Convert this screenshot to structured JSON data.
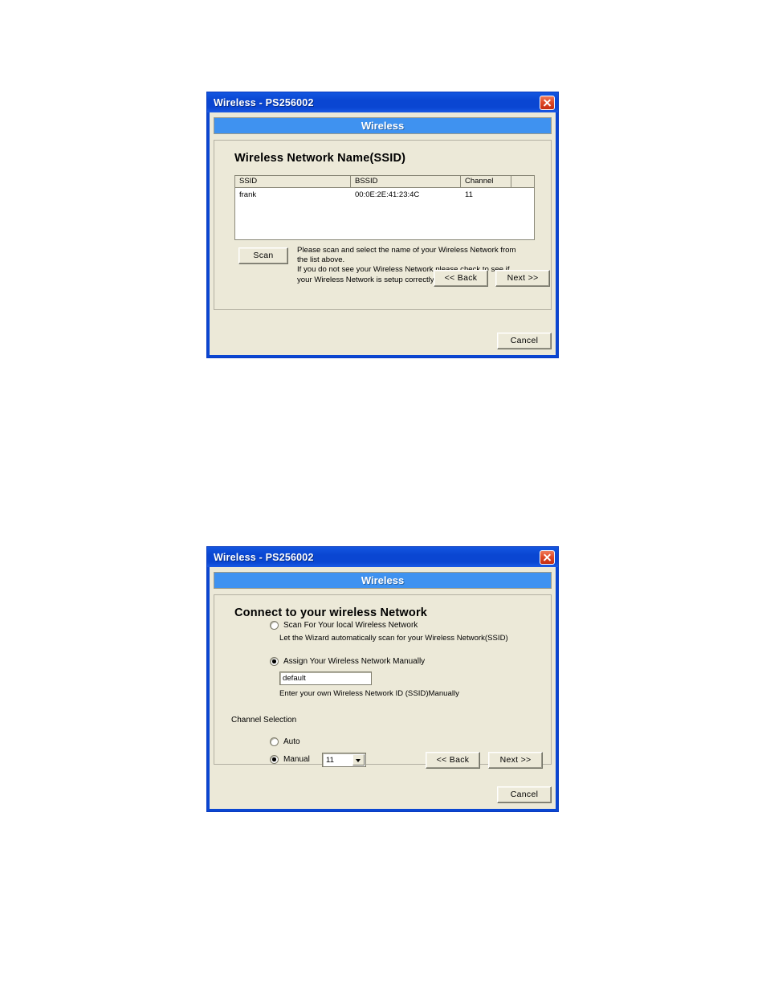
{
  "dialog1": {
    "title": "Wireless - PS256002",
    "close_icon": "close-icon",
    "banner": "Wireless",
    "section_title": "Wireless Network Name(SSID)",
    "table": {
      "columns": [
        "SSID",
        "BSSID",
        "Channel",
        ""
      ],
      "rows": [
        [
          "frank",
          "00:0E:2E:41:23:4C",
          "11",
          ""
        ]
      ]
    },
    "scan_label": "Scan",
    "note_line1": "Please scan and select the name of your Wireless Network from",
    "note_line2": "the list above.",
    "note_line3": "If you do not see your Wireless Network please check to see if",
    "note_line4": "your Wireless Network is setup correctly and re-scan.",
    "back_label": "<< Back",
    "next_label": "Next >>",
    "cancel_label": "Cancel"
  },
  "dialog2": {
    "title": "Wireless - PS256002",
    "close_icon": "close-icon",
    "banner": "Wireless",
    "section_title": "Connect to your wireless Network",
    "option_scan_label": "Scan For Your local Wireless Network",
    "option_scan_note": "Let the Wizard automatically scan for your Wireless Network(SSID)",
    "option_manual_label": "Assign Your Wireless Network Manually",
    "ssid_value": "default",
    "ssid_note": "Enter your own Wireless Network ID (SSID)Manually",
    "channel_selection_label": "Channel Selection",
    "channel_auto_label": "Auto",
    "channel_manual_label": "Manual",
    "channel_value": "11",
    "back_label": "<< Back",
    "next_label": "Next >>",
    "cancel_label": "Cancel"
  },
  "colors": {
    "titlebar": "#0a46d2",
    "banner": "#3f92f0",
    "face": "#ece9d8",
    "close": "#c42d12"
  }
}
